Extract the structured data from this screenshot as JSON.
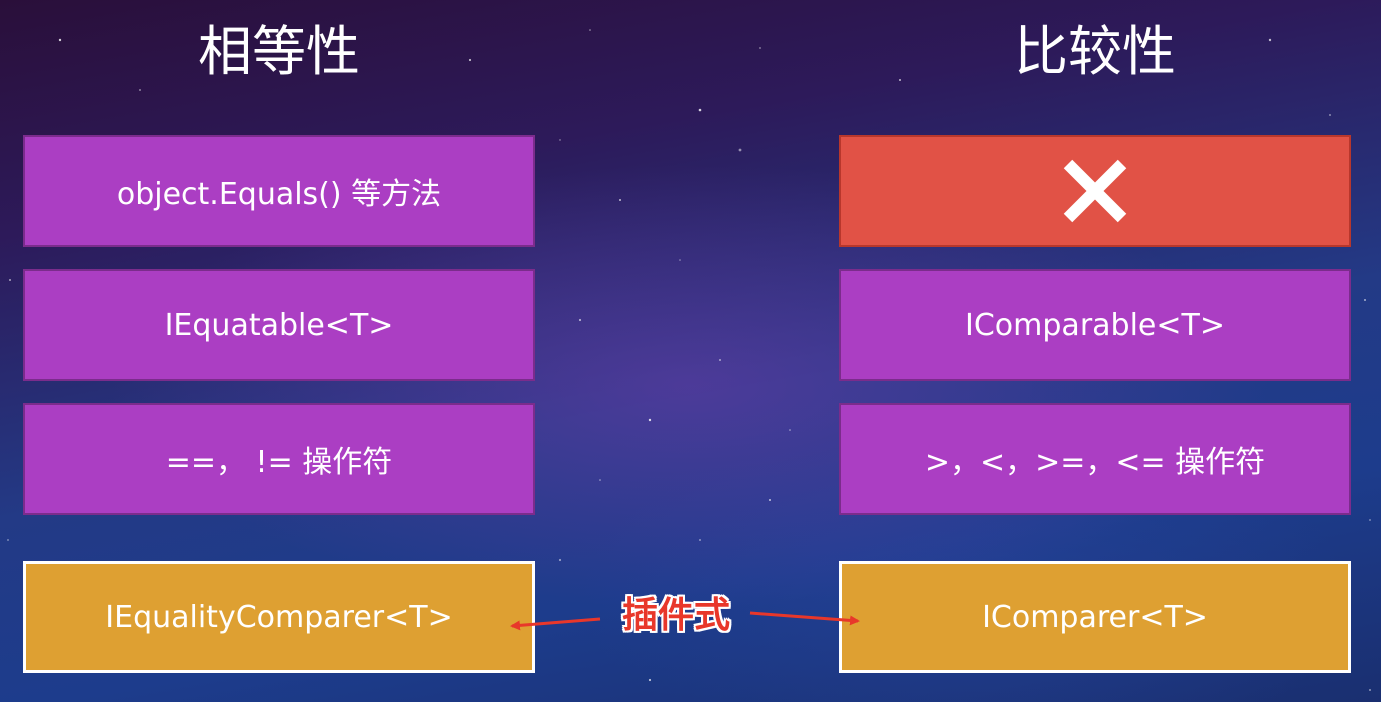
{
  "headings": {
    "left": "相等性",
    "right": "比较性"
  },
  "left_column": {
    "row1": "object.Equals() 等方法",
    "row2": "IEquatable<T>",
    "row3": "==， != 操作符",
    "row4": "IEqualityComparer<T>"
  },
  "right_column": {
    "row1_icon": "cross-icon",
    "row2": "IComparable<T>",
    "row3": ">，<，>=，<= 操作符",
    "row4": "IComparer<T>"
  },
  "connector": {
    "label": "插件式"
  },
  "colors": {
    "purple": "#ab3ec3",
    "red": "#e15246",
    "orange": "#dea032",
    "arrow": "#e8372a"
  }
}
